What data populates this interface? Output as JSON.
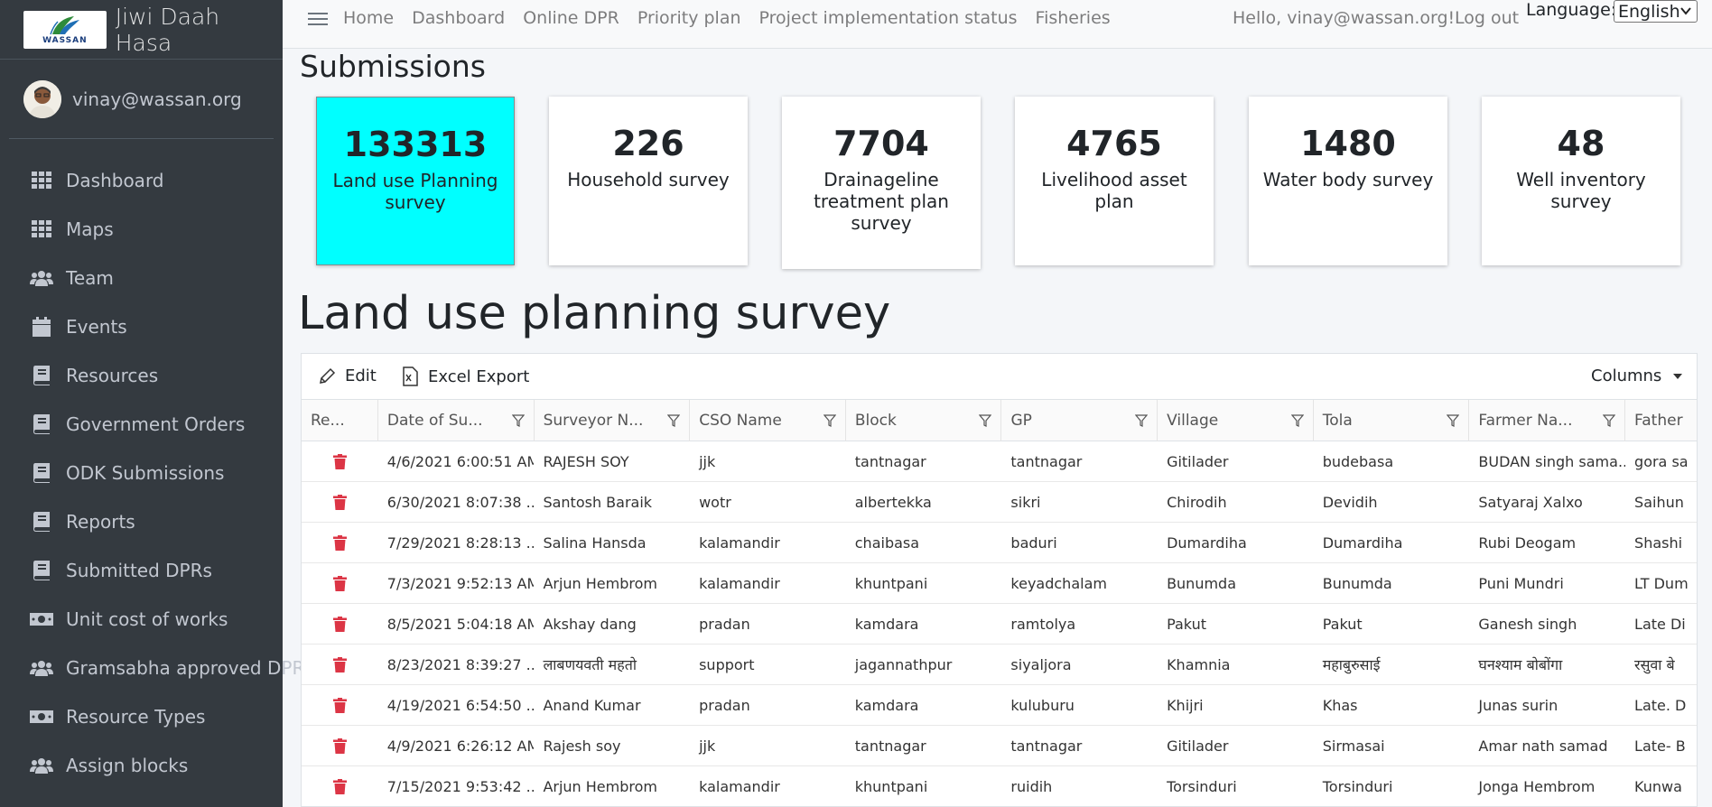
{
  "brand": {
    "name": "Jiwi Daah Hasa",
    "logo_text": "WASSAN"
  },
  "user": {
    "email": "vinay@wassan.org"
  },
  "sidebar": {
    "items": [
      {
        "label": "Dashboard",
        "icon": "grid-icon"
      },
      {
        "label": "Maps",
        "icon": "grid-icon"
      },
      {
        "label": "Team",
        "icon": "users-icon"
      },
      {
        "label": "Events",
        "icon": "calendar-icon"
      },
      {
        "label": "Resources",
        "icon": "book-icon"
      },
      {
        "label": "Government Orders",
        "icon": "book-icon"
      },
      {
        "label": "ODK Submissions",
        "icon": "book-icon"
      },
      {
        "label": "Reports",
        "icon": "book-icon"
      },
      {
        "label": "Submitted DPRs",
        "icon": "book-icon"
      },
      {
        "label": "Unit cost of works",
        "icon": "money-icon"
      },
      {
        "label": "Gramsabha approved DPR",
        "icon": "users-icon"
      },
      {
        "label": "Resource Types",
        "icon": "money-icon"
      },
      {
        "label": "Assign blocks",
        "icon": "users-icon"
      }
    ]
  },
  "topnav": {
    "links": [
      "Home",
      "Dashboard",
      "Online DPR",
      "Priority plan",
      "Project implementation status",
      "Fisheries"
    ],
    "hello": "Hello, vinay@wassan.org!",
    "logout": "Log out",
    "language_label": "Language:",
    "language_value": "English"
  },
  "page": {
    "title": "Submissions",
    "section_title": "Land use planning survey"
  },
  "cards": [
    {
      "count": "133313",
      "label": "Land use Planning survey",
      "active": true
    },
    {
      "count": "226",
      "label": "Household survey",
      "active": false
    },
    {
      "count": "7704",
      "label": "Drainageline treatment plan survey",
      "active": false
    },
    {
      "count": "4765",
      "label": "Livelihood asset plan",
      "active": false
    },
    {
      "count": "1480",
      "label": "Water body survey",
      "active": false
    },
    {
      "count": "48",
      "label": "Well inventory survey",
      "active": false
    }
  ],
  "colors": {
    "active_card": "#00ffff",
    "delete_icon": "#dc3545",
    "sidebar_bg": "#343a40"
  },
  "grid": {
    "toolbar": {
      "edit": "Edit",
      "export": "Excel Export",
      "columns": "Columns"
    },
    "columns": [
      "Re...",
      "Date of Su...",
      "Surveyor N...",
      "CSO Name",
      "Block",
      "GP",
      "Village",
      "Tola",
      "Farmer Na...",
      "Father"
    ],
    "rows": [
      [
        "4/6/2021 6:00:51 AM",
        "RAJESH SOY",
        "jjk",
        "tantnagar",
        "tantnagar",
        "Gitilader",
        "budebasa",
        "BUDAN singh sama...",
        "gora sa"
      ],
      [
        "6/30/2021 8:07:38 ...",
        "Santosh Baraik",
        "wotr",
        "albertekka",
        "sikri",
        "Chirodih",
        "Devidih",
        "Satyaraj Xalxo",
        "Saihun"
      ],
      [
        "7/29/2021 8:28:13 ...",
        "Salina Hansda",
        "kalamandir",
        "chaibasa",
        "baduri",
        "Dumardiha",
        "Dumardiha",
        "Rubi Deogam",
        "Shashi"
      ],
      [
        "7/3/2021 9:52:13 AM",
        "Arjun Hembrom",
        "kalamandir",
        "khuntpani",
        "keyadchalam",
        "Bunumda",
        "Bunumda",
        "Puni Mundri",
        "LT Dum"
      ],
      [
        "8/5/2021 5:04:18 AM",
        "Akshay dang",
        "pradan",
        "kamdara",
        "ramtolya",
        "Pakut",
        "Pakut",
        "Ganesh singh",
        "Late Di"
      ],
      [
        "8/23/2021 8:39:27 ...",
        "लाबणयवती महतो",
        "support",
        "jagannathpur",
        "siyaljora",
        "Khamnia",
        "महाबुरुसाई",
        "घनश्याम बोबोंगा",
        "रसुवा बे"
      ],
      [
        "4/19/2021 6:54:50 ...",
        "Anand Kumar",
        "pradan",
        "kamdara",
        "kuluburu",
        "Khijri",
        "Khas",
        "Junas surin",
        "Late. D"
      ],
      [
        "4/9/2021 6:26:12 AM",
        "Rajesh soy",
        "jjk",
        "tantnagar",
        "tantnagar",
        "Gitilader",
        "Sirmasai",
        "Amar nath samad",
        "Late- B"
      ],
      [
        "7/15/2021 9:53:42 ...",
        "Arjun Hembrom",
        "kalamandir",
        "khuntpani",
        "ruidih",
        "Torsinduri",
        "Torsinduri",
        "Jonga Hembrom",
        "Kunwa"
      ]
    ]
  }
}
